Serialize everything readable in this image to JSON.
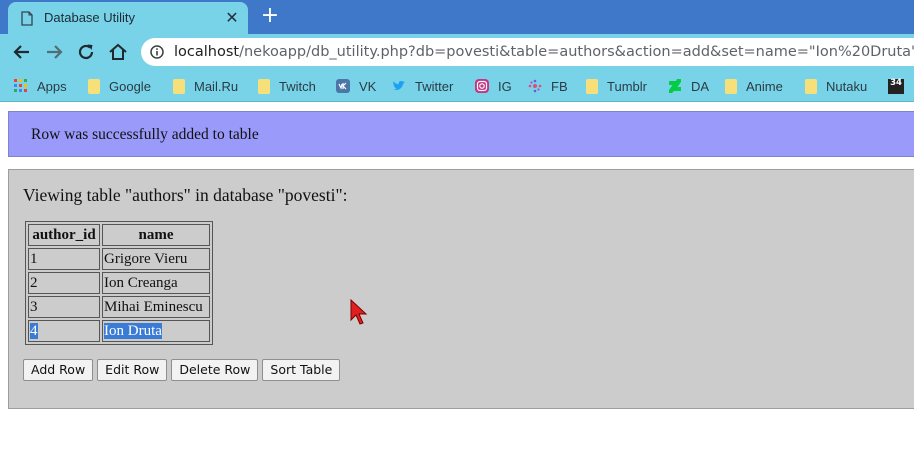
{
  "browser": {
    "tab": {
      "title": "Database Utility",
      "close_glyph": "✕"
    },
    "new_tab_glyph": "+",
    "toolbar": {
      "back_icon": "back-arrow-icon",
      "forward_icon": "forward-arrow-icon",
      "reload_icon": "reload-icon",
      "home_icon": "home-icon"
    },
    "address": {
      "host": "localhost",
      "path": "/nekoapp/db_utility.php?db=povesti&table=authors&action=add&set=name=\"Ion%20Druta\""
    },
    "bookmarks": [
      {
        "label": "Apps",
        "icon": "apps-grid-icon"
      },
      {
        "label": "Google",
        "icon": "folder-icon"
      },
      {
        "label": "Mail.Ru",
        "icon": "folder-icon"
      },
      {
        "label": "Twitch",
        "icon": "folder-icon"
      },
      {
        "label": "VK",
        "icon": "vk-icon"
      },
      {
        "label": "Twitter",
        "icon": "twitter-icon"
      },
      {
        "label": "IG",
        "icon": "instagram-icon"
      },
      {
        "label": "FB",
        "icon": "fb-icon"
      },
      {
        "label": "Tumblr",
        "icon": "folder-icon"
      },
      {
        "label": "DA",
        "icon": "deviantart-icon"
      },
      {
        "label": "Anime",
        "icon": "folder-icon"
      },
      {
        "label": "Nutaku",
        "icon": "folder-icon"
      },
      {
        "label": "",
        "icon": "site-34-icon",
        "badge": "34"
      }
    ]
  },
  "page": {
    "message": "Row was successfully added to table",
    "heading": "Viewing table \"authors\" in database \"povesti\":",
    "table": {
      "columns": [
        "author_id",
        "name"
      ],
      "rows": [
        [
          "1",
          "Grigore Vieru"
        ],
        [
          "2",
          "Ion Creanga"
        ],
        [
          "3",
          "Mihai Eminescu"
        ],
        [
          "4",
          "Ion Druta"
        ]
      ],
      "selected_row": 3
    },
    "buttons": {
      "add": "Add Row",
      "edit": "Edit Row",
      "delete": "Delete Row",
      "sort": "Sort Table"
    }
  },
  "colors": {
    "tabstrip": "#3f78c9",
    "toolbar": "#79d3e8",
    "message_bg": "#9a9afb",
    "panel_bg": "#cccccc",
    "selection": "#3a7bd5",
    "cursor": "#e02020"
  }
}
